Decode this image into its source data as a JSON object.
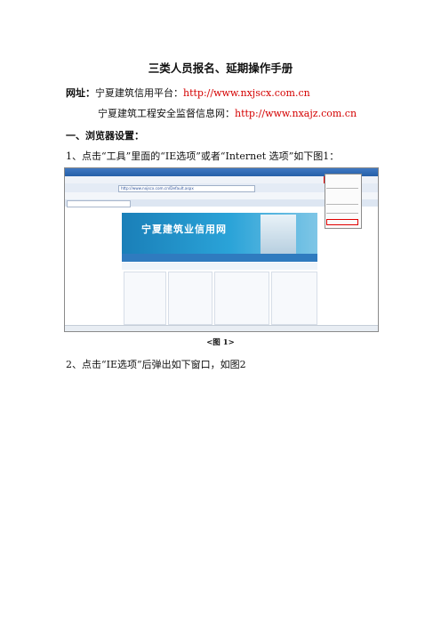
{
  "doc": {
    "title": "三类人员报名、延期操作手册",
    "website_label": "网址：",
    "site1_name": "宁夏建筑信用平台：",
    "site1_url": "http://www.nxjscx.com.cn",
    "site2_name": "宁夏建筑工程安全监督信息网：",
    "site2_url": "http://www.nxajz.com.cn",
    "section1": "一、浏览器设置：",
    "step1": "1、点击“工具”里面的“IE选项”或者“Internet  选项”如下图1：",
    "caption1": "<图 1>",
    "step2": "2、点击“IE选项”后弹出如下窗口，如图2"
  },
  "screenshot": {
    "address": "http://www.nxjscx.com.cn/Default.aspx",
    "banner": "宁夏建筑业信用网",
    "menu_tools": "工具(T)"
  }
}
